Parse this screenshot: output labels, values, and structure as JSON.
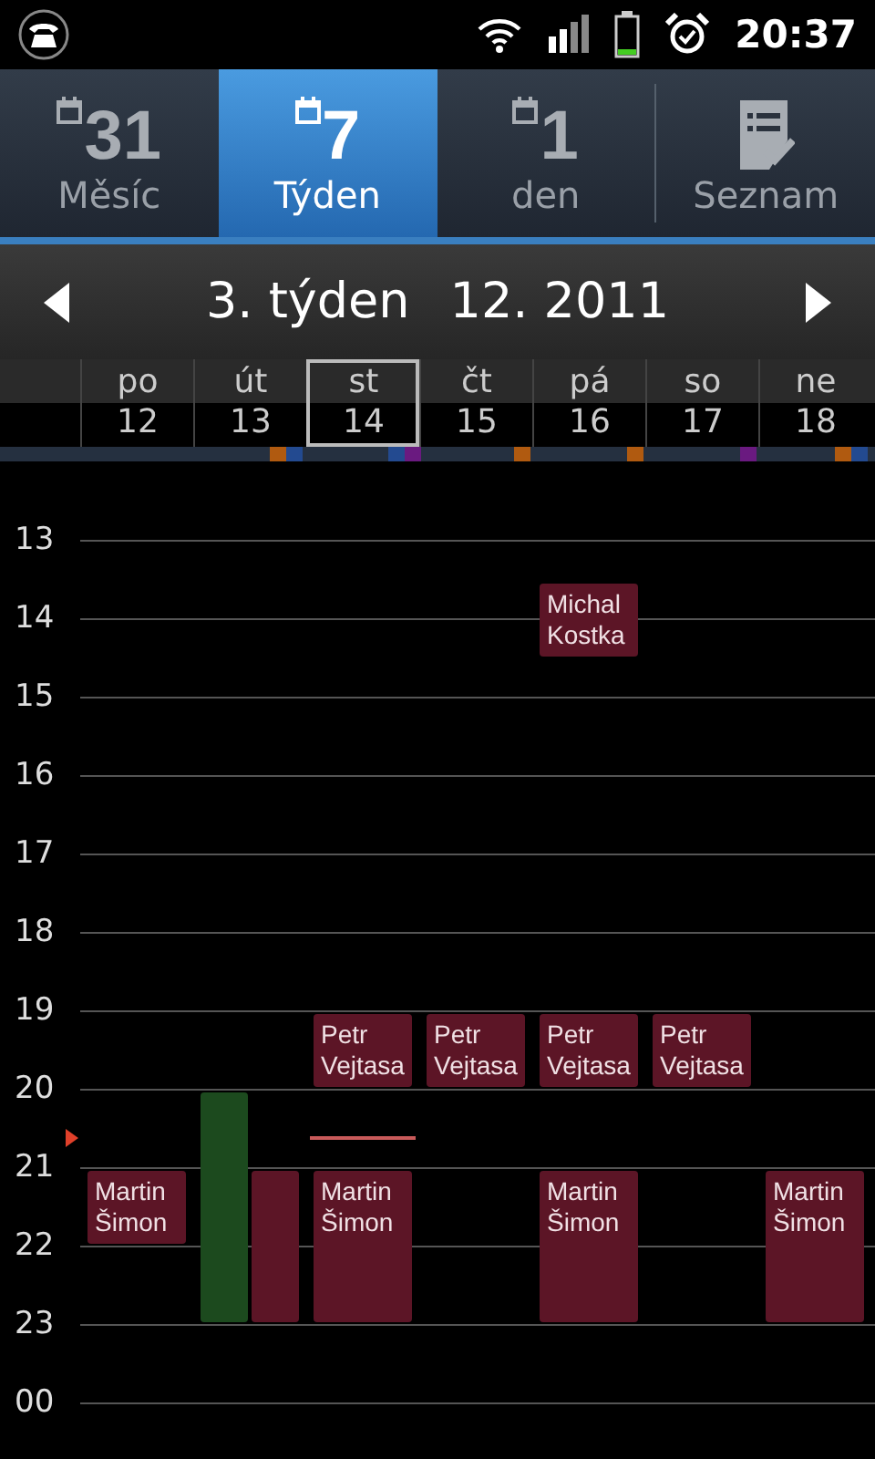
{
  "status_bar": {
    "time": "20:37"
  },
  "tabs": [
    {
      "icon_number": "31",
      "label": "Měsíc",
      "kind": "calendar",
      "selected": false
    },
    {
      "icon_number": "7",
      "label": "Týden",
      "kind": "calendar",
      "selected": true
    },
    {
      "icon_number": "1",
      "label": "den",
      "kind": "calendar",
      "selected": false
    },
    {
      "label": "Seznam",
      "kind": "list",
      "selected": false
    }
  ],
  "week_nav": {
    "week": "3. týden",
    "month": "12. 2011"
  },
  "days": [
    {
      "name": "po",
      "date": "12",
      "selected": false
    },
    {
      "name": "út",
      "date": "13",
      "selected": false
    },
    {
      "name": "st",
      "date": "14",
      "selected": true
    },
    {
      "name": "čt",
      "date": "15",
      "selected": false
    },
    {
      "name": "pá",
      "date": "16",
      "selected": false
    },
    {
      "name": "so",
      "date": "17",
      "selected": false
    },
    {
      "name": "ne",
      "date": "18",
      "selected": false
    }
  ],
  "hours": [
    "13",
    "14",
    "15",
    "16",
    "17",
    "18",
    "19",
    "20",
    "21",
    "22",
    "23",
    "00"
  ],
  "events": [
    {
      "title": "Michal Kostka",
      "color": "#5c1526"
    },
    {
      "title": "Petr Vejtasa",
      "color": "#5c1526"
    },
    {
      "title": "Petr Vejtasa",
      "color": "#5c1526"
    },
    {
      "title": "Petr Vejtasa",
      "color": "#5c1526"
    },
    {
      "title": "Petr Vejtasa",
      "color": "#5c1526"
    },
    {
      "color": "#1c4a1e"
    },
    {
      "title": "Martin Šimon",
      "color": "#5c1526"
    },
    {
      "color": "#5c1526"
    },
    {
      "title": "Martin Šimon",
      "color": "#5c1526"
    },
    {
      "title": "Martin Šimon",
      "color": "#5c1526"
    },
    {
      "title": "Martin Šimon",
      "color": "#5c1526"
    }
  ]
}
